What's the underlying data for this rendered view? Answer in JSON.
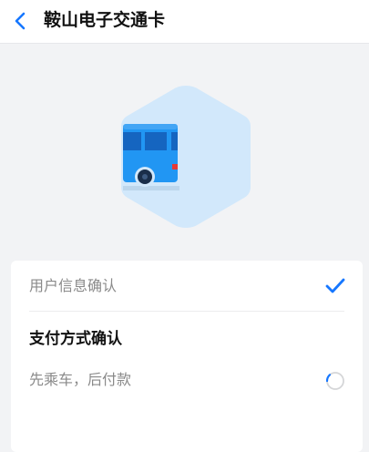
{
  "header": {
    "title": "鞍山电子交通卡",
    "back_icon": "chevron-left-icon"
  },
  "hero": {
    "icon": "bus-icon",
    "colors": {
      "hexagon": "#d2e8fb",
      "bus_body": "#2196f3",
      "bus_windows": "#1565c0"
    }
  },
  "card": {
    "user_info": {
      "label": "用户信息确认",
      "status_icon": "checkmark-icon"
    },
    "payment": {
      "section_title": "支付方式确认",
      "option_label": "先乘车，后付款",
      "status_icon": "loading-spinner-icon"
    }
  },
  "colors": {
    "accent": "#1677ff",
    "background": "#f2f3f5"
  }
}
